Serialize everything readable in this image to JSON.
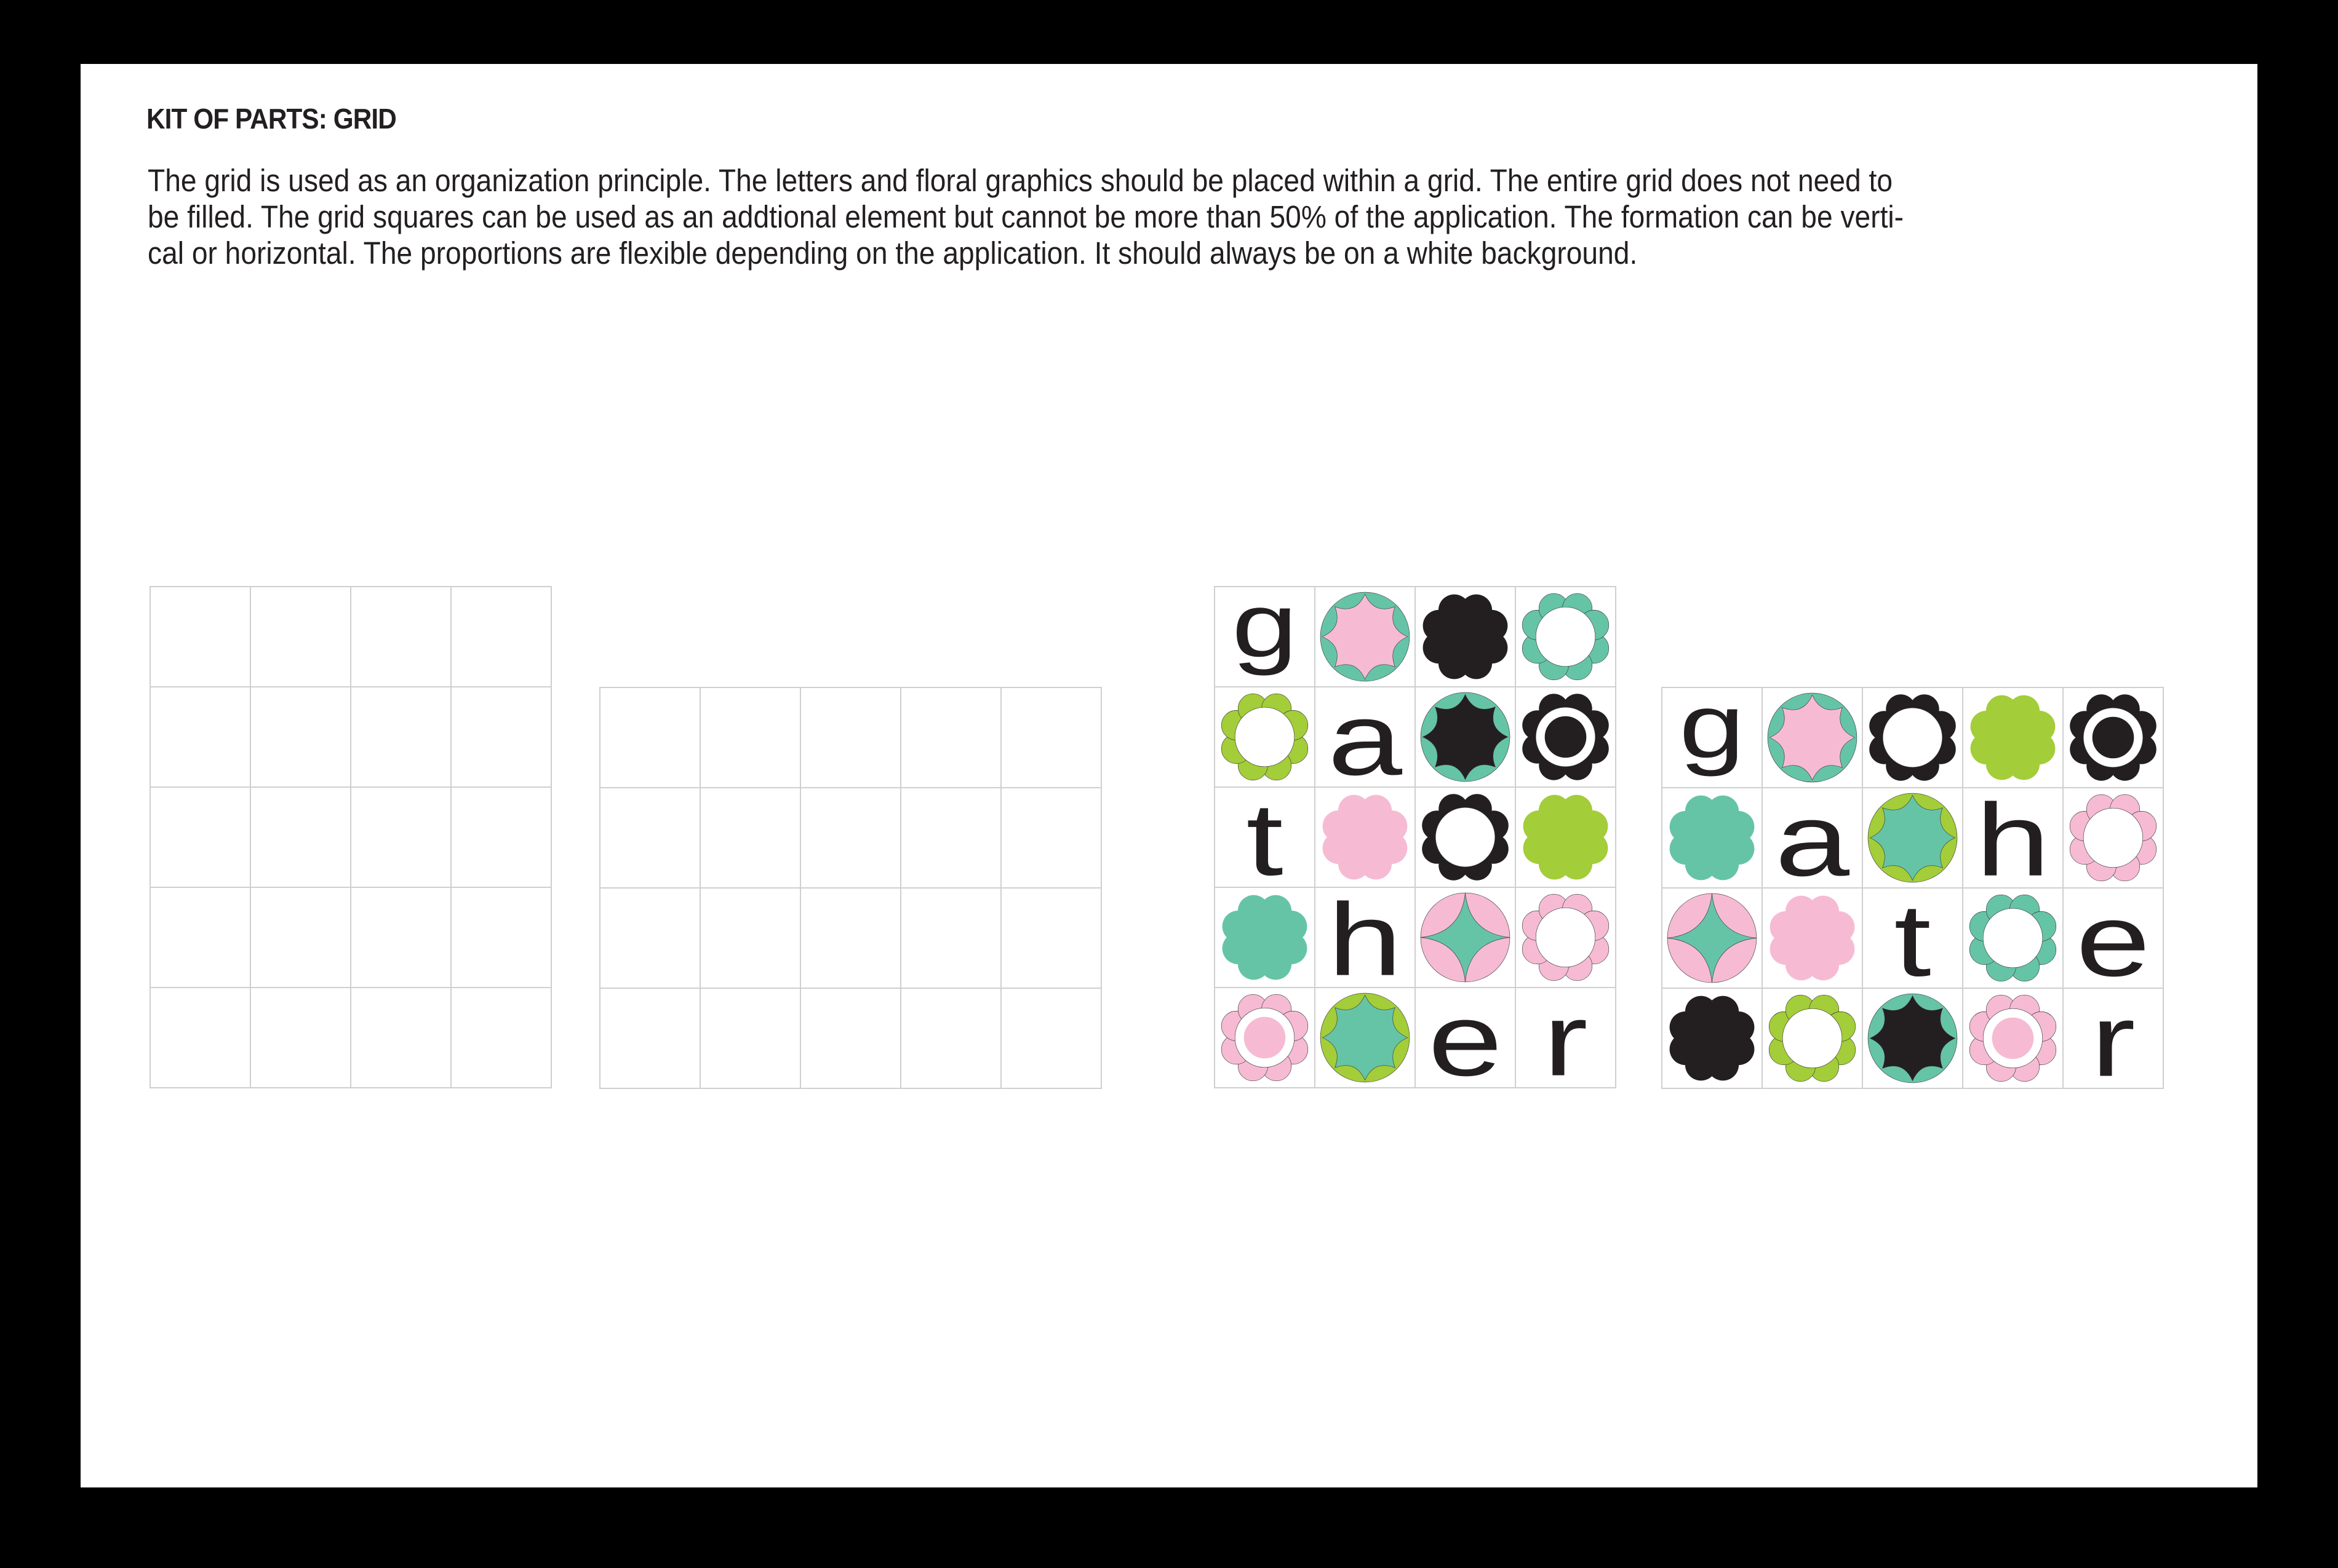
{
  "title": "KIT OF PARTS: GRID",
  "paragraph_lines": [
    "The grid is used as an organization principle. The letters and floral graphics should be placed within a grid. The entire grid does not need to",
    "be filled. The grid squares can be used as an addtional element but cannot be more than 50% of the application. The formation can be verti-",
    "cal or horizontal. The proportions are flexible depending on the application. It should always be on a white background."
  ],
  "colors": {
    "teal": "#66C4A6",
    "pink": "#F6BBD3",
    "green": "#A3CD39",
    "black": "#231F20",
    "grid_line": "#CFCFCF"
  },
  "grids": [
    {
      "name": "empty-vertical-grid",
      "cols": 4,
      "rows": 5,
      "cells": []
    },
    {
      "name": "empty-horizontal-grid",
      "cols": 5,
      "rows": 4,
      "cells": []
    },
    {
      "name": "vertical-gather-grid",
      "cols": 4,
      "rows": 5,
      "cells": [
        {
          "type": "letter",
          "letter": "g"
        },
        {
          "type": "medallion",
          "color": "teal",
          "inner": "pink"
        },
        {
          "type": "flower",
          "color": "black"
        },
        {
          "type": "ring-flower",
          "color": "teal"
        },
        {
          "type": "ring-flower",
          "color": "green"
        },
        {
          "type": "letter",
          "letter": "a"
        },
        {
          "type": "medallion",
          "color": "teal",
          "inner": "black"
        },
        {
          "type": "overlap-flower",
          "color": "black"
        },
        {
          "type": "letter",
          "letter": "t"
        },
        {
          "type": "flower",
          "color": "pink"
        },
        {
          "type": "ring-flower",
          "color": "black"
        },
        {
          "type": "flower",
          "color": "green"
        },
        {
          "type": "flower",
          "color": "teal"
        },
        {
          "type": "letter",
          "letter": "h"
        },
        {
          "type": "diamond-medallion",
          "color": "pink",
          "inner": "teal"
        },
        {
          "type": "ring-flower",
          "color": "pink"
        },
        {
          "type": "overlap-flower",
          "color": "pink"
        },
        {
          "type": "medallion",
          "color": "green",
          "inner": "teal"
        },
        {
          "type": "letter",
          "letter": "e"
        },
        {
          "type": "letter",
          "letter": "r"
        }
      ]
    },
    {
      "name": "horizontal-gather-grid",
      "cols": 5,
      "rows": 4,
      "cells": [
        {
          "type": "letter",
          "letter": "g"
        },
        {
          "type": "medallion",
          "color": "teal",
          "inner": "pink"
        },
        {
          "type": "ring-flower",
          "color": "black"
        },
        {
          "type": "flower",
          "color": "green"
        },
        {
          "type": "overlap-flower",
          "color": "black"
        },
        {
          "type": "flower",
          "color": "teal"
        },
        {
          "type": "letter",
          "letter": "a"
        },
        {
          "type": "medallion",
          "color": "green",
          "inner": "teal"
        },
        {
          "type": "letter",
          "letter": "h"
        },
        {
          "type": "ring-flower",
          "color": "pink"
        },
        {
          "type": "diamond-medallion",
          "color": "pink",
          "inner": "teal"
        },
        {
          "type": "flower",
          "color": "pink"
        },
        {
          "type": "letter",
          "letter": "t"
        },
        {
          "type": "ring-flower",
          "color": "teal"
        },
        {
          "type": "letter",
          "letter": "e"
        },
        {
          "type": "flower",
          "color": "black"
        },
        {
          "type": "ring-flower",
          "color": "green"
        },
        {
          "type": "medallion",
          "color": "teal",
          "inner": "black"
        },
        {
          "type": "overlap-flower",
          "color": "pink"
        },
        {
          "type": "letter",
          "letter": "r"
        }
      ]
    }
  ]
}
